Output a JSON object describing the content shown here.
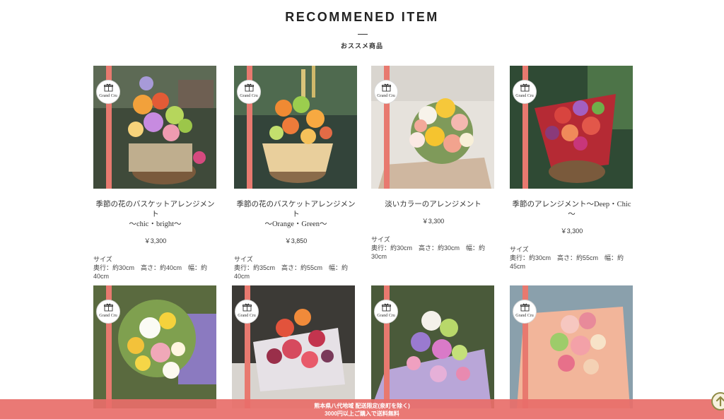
{
  "section": {
    "title": "RECOMMENED ITEM",
    "subtitle": "おススメ商品"
  },
  "badge_text": "Grand Cru",
  "size_label": "サイズ",
  "products": [
    {
      "name_line1": "季節の花のバスケットアレンジメント",
      "name_line2": "～chic・bright～",
      "price": "￥3,300",
      "size": "奥行：約30cm　高さ：約40cm　幅：約40cm",
      "image": "colorful flower basket arrangement"
    },
    {
      "name_line1": "季節の花のバスケットアレンジメント",
      "name_line2": "～Orange・Green～",
      "price": "￥3,850",
      "size": "奥行：約35cm　高さ：約55cm　幅：約40cm",
      "image": "orange and green flower basket"
    },
    {
      "name_line1": "淡いカラーのアレンジメント",
      "name_line2": "",
      "price": "￥3,300",
      "size": "奥行：約30cm　高さ：約30cm　幅：約30cm",
      "image": "pale yellow and pink flower arrangement"
    },
    {
      "name_line1": "季節のアレンジメント～Deep・Chic～",
      "name_line2": "",
      "price": "￥3,300",
      "size": "奥行：約30cm　高さ：約55cm　幅：約45cm",
      "image": "deep red and purple flower arrangement"
    },
    {
      "image": "white lily and yellow flower arrangement"
    },
    {
      "image": "red and orange bouquet"
    },
    {
      "image": "purple and green flower arrangement"
    },
    {
      "image": "peach and pink bouquet"
    }
  ],
  "notice": {
    "line1": "熊本県八代地域 配送限定(泉町を除く)",
    "line2": "3000円以上ご購入で送料無料"
  },
  "colors": {
    "ribbon": "#e8796f",
    "notice_bar": "#e86e69",
    "scroll_top_border": "#8f8a45"
  },
  "icons": {
    "badge": "gift-icon",
    "scroll_top": "arrow-up-icon"
  }
}
